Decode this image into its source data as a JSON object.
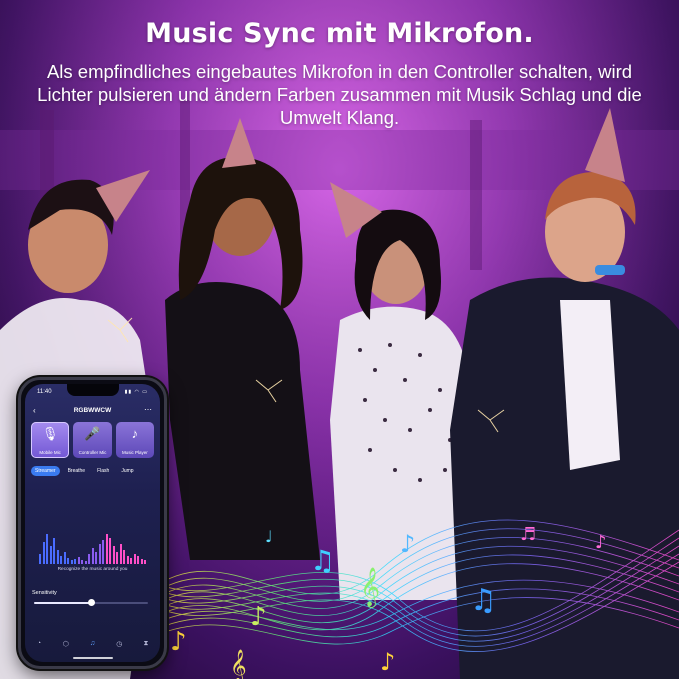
{
  "headline": "Music Sync mit Mikrofon.",
  "subline": "Als empfindliches eingebautes Mikrofon in den Controller schalten, wird Lichter pulsieren und ändern Farben zusammen mit Musik Schlag und die Umwelt Klang.",
  "phone": {
    "status": {
      "time": "11:40",
      "signal_icons": "signal-wifi-battery-icons"
    },
    "app_title": "RGBWWCW",
    "back_icon": "back-arrow-icon",
    "more_icon": "more-dots-icon",
    "modes": [
      {
        "label": "Mobile Mic",
        "icon": "microphone-icon",
        "glyph": "🎙",
        "active": true
      },
      {
        "label": "Controller Mic",
        "icon": "microphone-icon",
        "glyph": "🎤",
        "active": false
      },
      {
        "label": "Music Player",
        "icon": "music-note-icon",
        "glyph": "♪",
        "active": false
      }
    ],
    "effects": [
      {
        "label": "Streamer",
        "active": true
      },
      {
        "label": "Breathe",
        "active": false
      },
      {
        "label": "Flash",
        "active": false
      },
      {
        "label": "Jump",
        "active": false
      }
    ],
    "visualizer_caption": "Recognize the music around you",
    "sensitivity_label": "Sensitivity",
    "sensitivity_value": 0.5,
    "tabbar": [
      {
        "icon": "palette-icon",
        "glyph": "◔",
        "active": false
      },
      {
        "icon": "cube-icon",
        "glyph": "⬡",
        "active": false
      },
      {
        "icon": "music-tab-icon",
        "glyph": "♫",
        "active": true
      },
      {
        "icon": "timer-icon",
        "glyph": "◷",
        "active": false
      },
      {
        "icon": "hourglass-icon",
        "glyph": "⧗",
        "active": false
      }
    ]
  },
  "colors": {
    "background_glow": "#c34fd6",
    "accent_blue": "#3a7bf0",
    "mode_purple": "#7257d4"
  }
}
